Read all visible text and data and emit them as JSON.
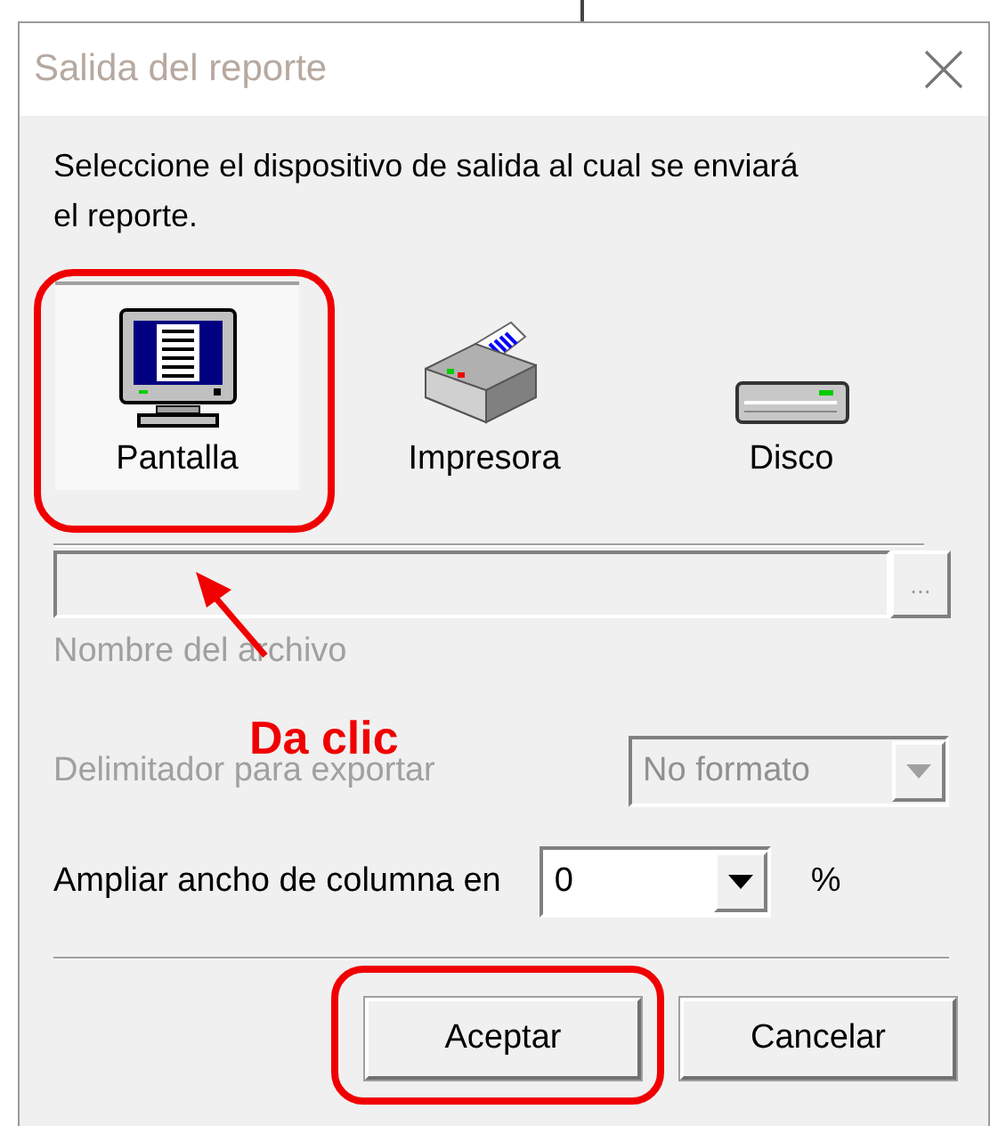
{
  "window": {
    "title": "Salida del reporte"
  },
  "instruction": "Seleccione el dispositivo de salida al cual se enviará el reporte.",
  "devices": [
    {
      "kind": "screen",
      "label": "Pantalla",
      "selected": true,
      "highlighted": true
    },
    {
      "kind": "printer",
      "label": "Impresora",
      "selected": false,
      "highlighted": false
    },
    {
      "kind": "disk",
      "label": "Disco",
      "selected": false,
      "highlighted": false
    }
  ],
  "file_field": {
    "label": "Nombre del archivo",
    "browse": "...",
    "disabled": true
  },
  "delimiter": {
    "label": "Delimitador para exportar",
    "value": "No formato",
    "disabled": true
  },
  "widen": {
    "label": "Ampliar ancho de columna en",
    "value": "0",
    "unit": "%",
    "disabled": false
  },
  "buttons": [
    {
      "label": "Aceptar",
      "highlighted": true
    },
    {
      "label": "Cancelar",
      "highlighted": false
    }
  ],
  "callout": "Da clic"
}
